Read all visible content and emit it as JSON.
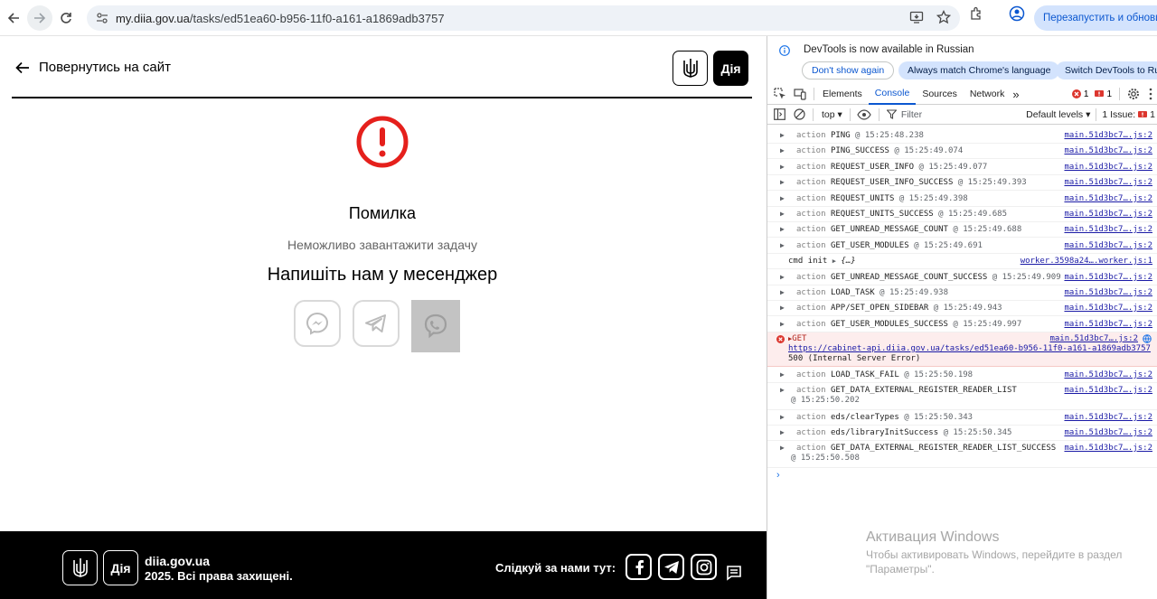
{
  "browser": {
    "url_host": "my.diia.gov.ua",
    "url_path": "/tasks/ed51ea60-b956-11f0-a161-a1869adb3757",
    "relaunch_label": "Перезапустить и обновить"
  },
  "page": {
    "back_label": "Повернутись на сайт",
    "brand_text": "Дія",
    "error_title": "Помилка",
    "error_message": "Неможливо завантажити задачу",
    "contact_heading": "Напишіть нам у месенджер",
    "messengers": [
      "messenger",
      "telegram",
      "viber"
    ]
  },
  "footer": {
    "brand_text": "Дія",
    "site": "diia.gov.ua",
    "copyright": "2025. Всі права захищені.",
    "follow_label": "Слідкуй за нами тут:"
  },
  "devtools": {
    "info_message": "DevTools is now available in Russian",
    "btn_dont_show": "Don't show again",
    "btn_match_lang": "Always match Chrome's language",
    "btn_switch": "Switch DevTools to Rus",
    "tabs": [
      "Elements",
      "Console",
      "Sources",
      "Network"
    ],
    "more_tabs": "»",
    "error_count": "1",
    "issue_count": "1",
    "context": "top",
    "filter_placeholder": "Filter",
    "levels": "Default levels",
    "issues_label": "1 Issue:",
    "issues_count": "1",
    "logs": [
      {
        "kw": "action",
        "name": "PING",
        "time": "@ 15:25:48.238",
        "src": "main.51d3bc7….js:2"
      },
      {
        "kw": "action",
        "name": "PING_SUCCESS",
        "time": "@ 15:25:49.074",
        "src": "main.51d3bc7….js:2"
      },
      {
        "kw": "action",
        "name": "REQUEST_USER_INFO",
        "time": "@ 15:25:49.077",
        "src": "main.51d3bc7….js:2"
      },
      {
        "kw": "action",
        "name": "REQUEST_USER_INFO_SUCCESS",
        "time": "@ 15:25:49.393",
        "src": "main.51d3bc7….js:2"
      },
      {
        "kw": "action",
        "name": "REQUEST_UNITS",
        "time": "@ 15:25:49.398",
        "src": "main.51d3bc7….js:2"
      },
      {
        "kw": "action",
        "name": "REQUEST_UNITS_SUCCESS",
        "time": "@ 15:25:49.685",
        "src": "main.51d3bc7….js:2"
      },
      {
        "kw": "action",
        "name": "GET_UNREAD_MESSAGE_COUNT",
        "time": "@ 15:25:49.688",
        "src": "main.51d3bc7….js:2"
      },
      {
        "kw": "action",
        "name": "GET_USER_MODULES",
        "time": "@ 15:25:49.691",
        "src": "main.51d3bc7….js:2"
      }
    ],
    "cmd_init": {
      "text": "cmd init",
      "obj": "{…}",
      "src": "worker.3598a24….worker.js:1"
    },
    "logs2": [
      {
        "kw": "action",
        "name": "GET_UNREAD_MESSAGE_COUNT_SUCCESS",
        "time": "@ 15:25:49.909",
        "src": "main.51d3bc7….js:2"
      },
      {
        "kw": "action",
        "name": "LOAD_TASK",
        "time": "@ 15:25:49.938",
        "src": "main.51d3bc7….js:2"
      },
      {
        "kw": "action",
        "name": "APP/SET_OPEN_SIDEBAR",
        "time": "@ 15:25:49.943",
        "src": "main.51d3bc7….js:2"
      },
      {
        "kw": "action",
        "name": "GET_USER_MODULES_SUCCESS",
        "time": "@ 15:25:49.997",
        "src": "main.51d3bc7….js:2"
      }
    ],
    "error_row": {
      "method": "GET",
      "src": "main.51d3bc7….js:2",
      "url": "https://cabinet-api.diia.gov.ua/tasks/ed51ea60-b956-11f0-a161-a1869adb3757",
      "status": "500 (Internal Server Error)"
    },
    "logs3": [
      {
        "kw": "action",
        "name": "LOAD_TASK_FAIL",
        "time": "@ 15:25:50.198",
        "src": "main.51d3bc7….js:2"
      },
      {
        "kw": "action",
        "name": "GET_DATA_EXTERNAL_REGISTER_READER_LIST",
        "time": "@ 15:25:50.202",
        "src": "main.51d3bc7….js:2"
      },
      {
        "kw": "action",
        "name": "eds/clearTypes",
        "time": "@ 15:25:50.343",
        "src": "main.51d3bc7….js:2"
      },
      {
        "kw": "action",
        "name": "eds/libraryInitSuccess",
        "time": "@ 15:25:50.345",
        "src": "main.51d3bc7….js:2"
      },
      {
        "kw": "action",
        "name": "GET_DATA_EXTERNAL_REGISTER_READER_LIST_SUCCESS",
        "time": "@ 15:25:50.508",
        "src": "main.51d3bc7….js:2"
      }
    ]
  },
  "watermark": {
    "title": "Активация Windows",
    "line": "Чтобы активировать Windows, перейдите в раздел \"Параметры\"."
  }
}
